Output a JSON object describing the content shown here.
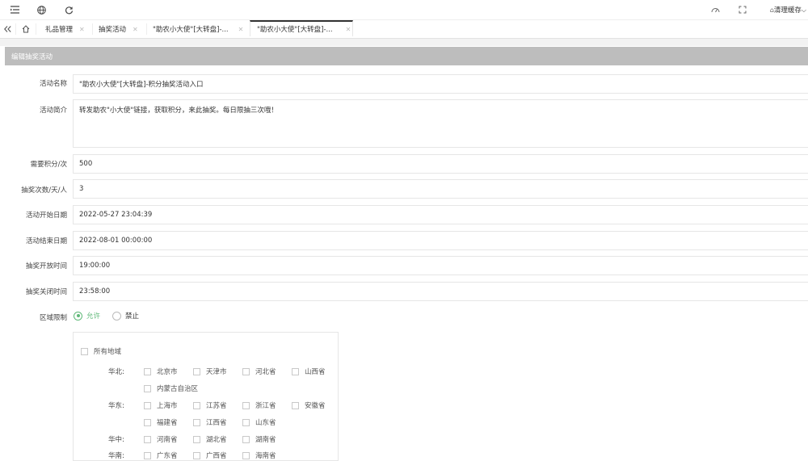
{
  "topbar": {
    "icons": [
      "menu-icon",
      "globe-icon",
      "refresh-icon",
      "theme-icon",
      "fullscreen-icon"
    ],
    "clear_cache_label": "清理缓存"
  },
  "tabs": [
    {
      "label": "礼品管理",
      "active": false
    },
    {
      "label": "抽奖活动",
      "active": false
    },
    {
      "label": "\"助农小大使\"[大转盘]-...",
      "active": false
    },
    {
      "label": "\"助农小大使\"[大转盘]-...",
      "active": true
    }
  ],
  "panel": {
    "title": "编辑抽奖活动"
  },
  "form": {
    "name": {
      "label": "活动名称",
      "value": "\"助农小大使\"[大转盘]-积分抽奖活动入口"
    },
    "intro": {
      "label": "活动简介",
      "value": "转发助农\"小大使\"链接，获取积分，来此抽奖。每日限抽三次哦！"
    },
    "points": {
      "label": "需要积分/次",
      "value": "500"
    },
    "times": {
      "label": "抽奖次数/天/人",
      "value": "3"
    },
    "start_date": {
      "label": "活动开始日期",
      "value": "2022-05-27 23:04:39"
    },
    "end_date": {
      "label": "活动结束日期",
      "value": "2022-08-01 00:00:00"
    },
    "open_time": {
      "label": "抽奖开放时间",
      "value": "19:00:00"
    },
    "close_time": {
      "label": "抽奖关闭时间",
      "value": "23:58:00"
    },
    "region": {
      "label": "区域限制",
      "allow": "允许",
      "deny": "禁止",
      "all_label": "所有地域",
      "groups": [
        {
          "name": "华北:",
          "rows": [
            [
              "北京市",
              "天津市",
              "河北省",
              "山西省"
            ],
            [
              "内蒙古自治区"
            ]
          ]
        },
        {
          "name": "华东:",
          "rows": [
            [
              "上海市",
              "江苏省",
              "浙江省",
              "安徽省"
            ],
            [
              "福建省",
              "江西省",
              "山东省"
            ]
          ]
        },
        {
          "name": "华中:",
          "rows": [
            [
              "河南省",
              "湖北省",
              "湖南省"
            ]
          ]
        },
        {
          "name": "华南:",
          "rows": [
            [
              "广东省",
              "广西省",
              "海南省"
            ]
          ]
        }
      ]
    }
  }
}
